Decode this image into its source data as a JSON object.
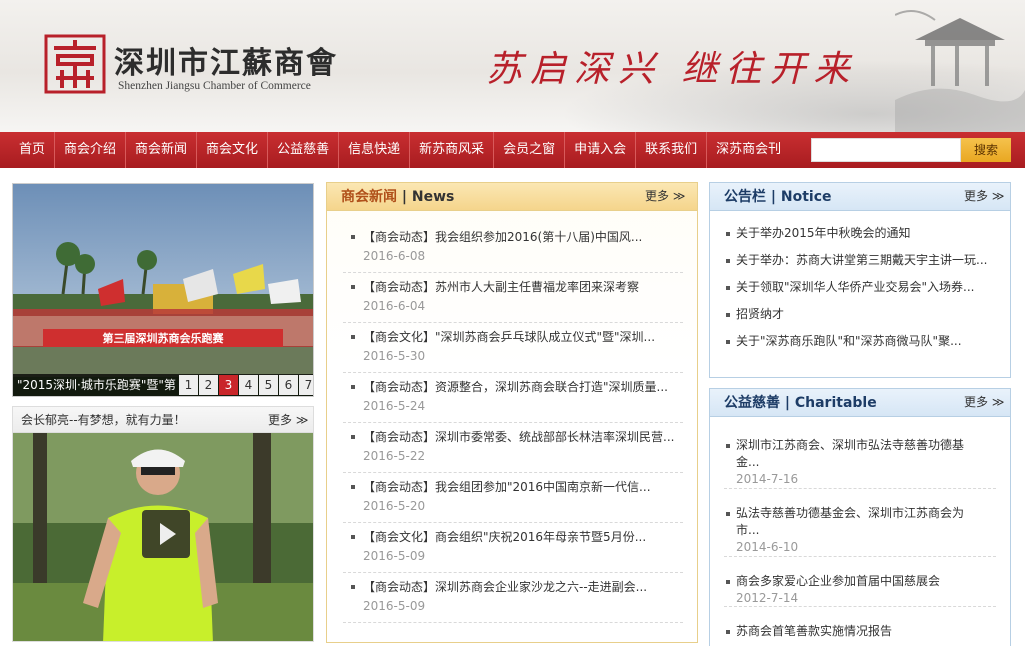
{
  "header": {
    "logo_cn": "深圳市江蘇商會",
    "logo_en": "Shenzhen Jiangsu Chamber of Commerce",
    "slogan": "苏启深兴 继往开来"
  },
  "nav": {
    "items": [
      "首页",
      "商会介绍",
      "商会新闻",
      "商会文化",
      "公益慈善",
      "信息快递",
      "新苏商风采",
      "会员之窗",
      "申请入会",
      "联系我们",
      "深苏商会刊"
    ],
    "search_placeholder": "",
    "search_label": "搜索"
  },
  "slideshow": {
    "caption": "\"2015深圳·城市乐跑赛\"暨\"第",
    "banner_text": "第三届深圳苏商会乐跑赛",
    "pages": [
      "1",
      "2",
      "3",
      "4",
      "5",
      "6",
      "7"
    ],
    "active_page": "3"
  },
  "video": {
    "title": "会长郁亮--有梦想，就有力量！",
    "more": "更多 ≫"
  },
  "news": {
    "title_cn": "商会新闻",
    "title_en": "| News",
    "more": "更多 ≫",
    "items": [
      {
        "title": "【商会动态】我会组织参加2016(第十八届)中国风...",
        "date": "2016-6-08"
      },
      {
        "title": "【商会动态】苏州市人大副主任曹福龙率团来深考察",
        "date": "2016-6-04"
      },
      {
        "title": "【商会文化】\"深圳苏商会乒乓球队成立仪式\"暨\"深圳...",
        "date": "2016-5-30"
      },
      {
        "title": "【商会动态】资源整合，深圳苏商会联合打造\"深圳质量...",
        "date": "2016-5-24"
      },
      {
        "title": "【商会动态】深圳市委常委、统战部部长林洁率深圳民营...",
        "date": "2016-5-22"
      },
      {
        "title": "【商会动态】我会组团参加\"2016中国南京新一代信...",
        "date": "2016-5-20"
      },
      {
        "title": "【商会文化】商会组织\"庆祝2016年母亲节暨5月份...",
        "date": "2016-5-09"
      },
      {
        "title": "【商会动态】深圳苏商会企业家沙龙之六--走进副会...",
        "date": "2016-5-09"
      }
    ]
  },
  "notice": {
    "title_cn": "公告栏",
    "title_en": "| Notice",
    "more": "更多 ≫",
    "items": [
      "关于举办2015年中秋晚会的通知",
      "关于举办：苏商大讲堂第三期戴天宇主讲一玩...",
      "关于领取\"深圳华人华侨产业交易会\"入场券...",
      "招贤纳才",
      "关于\"深苏商乐跑队\"和\"深苏商微马队\"聚..."
    ]
  },
  "charity": {
    "title_cn": "公益慈善",
    "title_en": "| Charitable",
    "more": "更多 ≫",
    "items": [
      {
        "title": "深圳市江苏商会、深圳市弘法寺慈善功德基金...",
        "date": "2014-7-16"
      },
      {
        "title": "弘法寺慈善功德基金会、深圳市江苏商会为市...",
        "date": "2014-6-10"
      },
      {
        "title": "商会多家爱心企业参加首届中国慈展会",
        "date": "2012-7-14"
      },
      {
        "title": "苏商会首笔善款实施情况报告",
        "date": ""
      }
    ]
  },
  "colors": {
    "nav_red": "#b52326",
    "slogan_red": "#b8202a",
    "news_header_gold": "#f5d58c",
    "panel_header_blue": "#d6e6f5",
    "active_page": "#c9262a"
  }
}
